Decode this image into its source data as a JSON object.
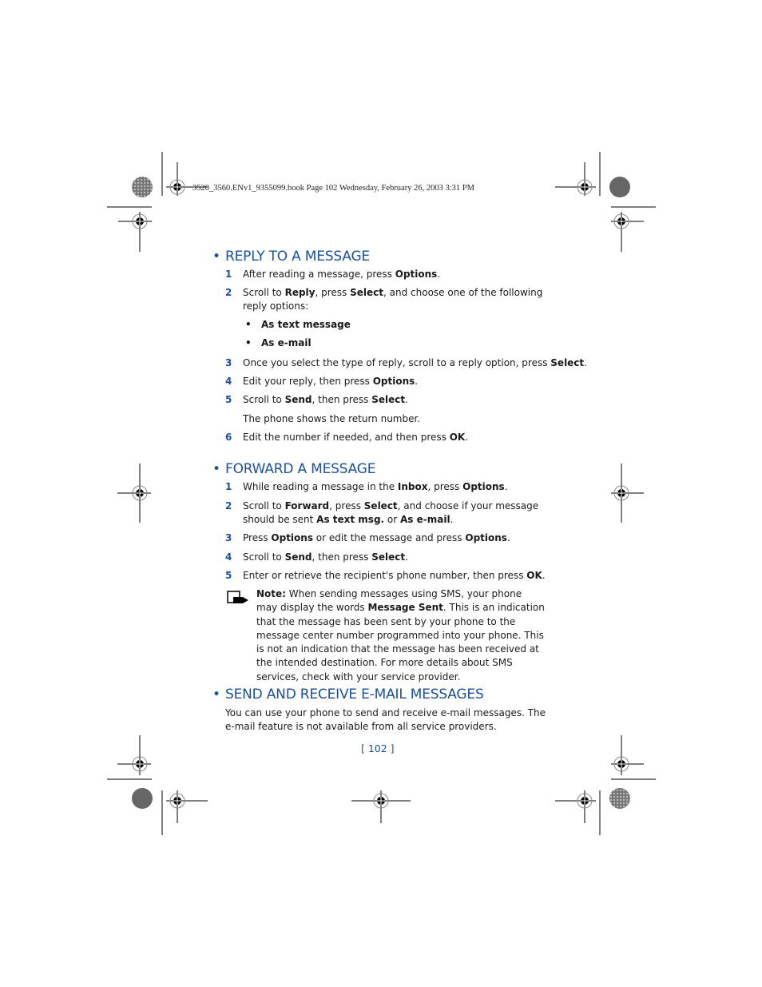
{
  "header": {
    "print_line": "3520_3560.ENv1_9355099.book  Page 102  Wednesday, February 26, 2003  3:31 PM"
  },
  "colors": {
    "accent": "#1c4f9c",
    "text": "#1a1a1a"
  },
  "sections": [
    {
      "title": "REPLY TO A MESSAGE",
      "bullet": "•",
      "steps": [
        {
          "num": "1",
          "parts": [
            [
              "After reading a message, press ",
              false
            ],
            [
              "Options",
              true
            ],
            [
              ".",
              false
            ]
          ]
        },
        {
          "num": "2",
          "parts": [
            [
              "Scroll to ",
              false
            ],
            [
              "Reply",
              true
            ],
            [
              ", press ",
              false
            ],
            [
              "Select",
              true
            ],
            [
              ", and choose one of the following reply options:",
              false
            ]
          ]
        },
        {
          "num": "3",
          "parts": [
            [
              "Once you select the type of reply, scroll to a reply option, press ",
              false
            ],
            [
              "Select",
              true
            ],
            [
              ".",
              false
            ]
          ]
        },
        {
          "num": "4",
          "parts": [
            [
              "Edit your reply, then press ",
              false
            ],
            [
              "Options",
              true
            ],
            [
              ".",
              false
            ]
          ]
        },
        {
          "num": "5",
          "parts": [
            [
              "Scroll to ",
              false
            ],
            [
              "Send",
              true
            ],
            [
              ", then press ",
              false
            ],
            [
              "Select",
              true
            ],
            [
              ".",
              false
            ]
          ]
        },
        {
          "num": "6",
          "parts": [
            [
              "Edit the number if needed, and then press ",
              false
            ],
            [
              "OK",
              true
            ],
            [
              ".",
              false
            ]
          ]
        }
      ],
      "sub_options": [
        "As text message",
        "As e-mail"
      ],
      "step5_note": "The phone shows the return number."
    },
    {
      "title": "FORWARD A MESSAGE",
      "bullet": "•",
      "steps": [
        {
          "num": "1",
          "parts": [
            [
              "While reading a message in the ",
              false
            ],
            [
              "Inbox",
              true
            ],
            [
              ", press ",
              false
            ],
            [
              "Options",
              true
            ],
            [
              ".",
              false
            ]
          ]
        },
        {
          "num": "2",
          "parts": [
            [
              "Scroll to ",
              false
            ],
            [
              "Forward",
              true
            ],
            [
              ", press ",
              false
            ],
            [
              "Select",
              true
            ],
            [
              ", and choose if your message should be sent ",
              false
            ],
            [
              "As text msg.",
              true
            ],
            [
              " or ",
              false
            ],
            [
              "As e-mail",
              true
            ],
            [
              ".",
              false
            ]
          ]
        },
        {
          "num": "3",
          "parts": [
            [
              "Press ",
              false
            ],
            [
              "Options",
              true
            ],
            [
              " or edit the message and press ",
              false
            ],
            [
              "Options",
              true
            ],
            [
              ".",
              false
            ]
          ]
        },
        {
          "num": "4",
          "parts": [
            [
              "Scroll to ",
              false
            ],
            [
              "Send",
              true
            ],
            [
              ", then press ",
              false
            ],
            [
              "Select",
              true
            ],
            [
              ".",
              false
            ]
          ]
        },
        {
          "num": "5",
          "parts": [
            [
              "Enter or retrieve the recipient's phone number, then press ",
              false
            ],
            [
              "OK",
              true
            ],
            [
              ".",
              false
            ]
          ]
        }
      ],
      "note": {
        "icon": "note-hand-icon",
        "parts": [
          [
            "Note:",
            true
          ],
          [
            " When sending messages using SMS, your phone may display the words ",
            false
          ],
          [
            "Message Sent",
            true
          ],
          [
            ". This is an indication that the message has been sent by your phone to the message center number programmed into your phone. This is not an indication that the message has been received at the intended destination. For more details about SMS services, check with your service provider.",
            false
          ]
        ]
      }
    },
    {
      "title": "SEND AND RECEIVE E-MAIL MESSAGES",
      "bullet": "•",
      "paragraph": "You can use your phone to send and receive e-mail messages. The e-mail feature is not available from all service providers."
    }
  ],
  "footer": {
    "page_number": "[ 102 ]"
  }
}
